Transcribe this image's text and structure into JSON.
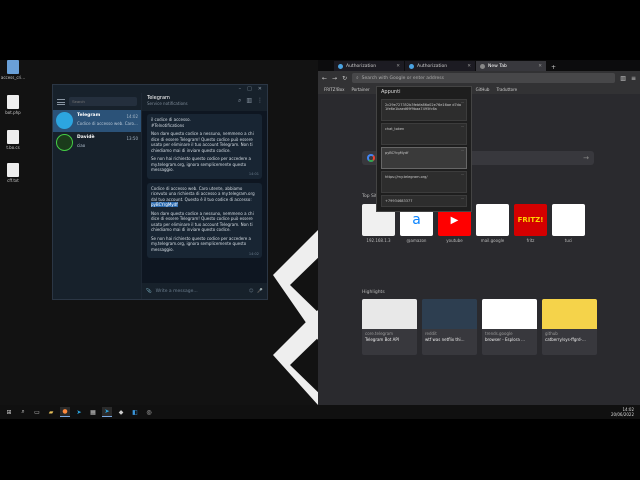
{
  "desktop": {
    "icons": [
      {
        "label": "access_cri..."
      },
      {
        "label": "bot.php"
      },
      {
        "label": "t.bo.cs"
      },
      {
        "label": "cff.txt"
      }
    ]
  },
  "telegram": {
    "search_placeholder": "Search",
    "chats": [
      {
        "name": "Telegram",
        "preview": "Codice di accesso web. Caro...",
        "time": "14:02",
        "avatar_color": "#2ca5e0"
      },
      {
        "name": "Davidè",
        "preview": "ciao",
        "time": "13:50",
        "avatar_color": "#1b3b1b"
      }
    ],
    "header_title": "Telegram",
    "header_subtitle": "Service notifications",
    "msg1": {
      "line1": "il codice di accesso.",
      "line2": "#Telnotifications",
      "para2": "Non dare questo codice a nessuno, nemmeno a chi dice di essere Telegram! Questo codice può essere usato per eliminare il tuo account Telegram. Non ti chiediamo mai di inviare questo codice.",
      "para3": "Se non hai richiesto questo codice per accedere a my.telegram.org, ignora semplicemente questo messaggio.",
      "time": "14:01"
    },
    "msg2": {
      "para1": "Codice di accesso web. Caro utente, abbiamo ricevuto una richiesta di accesso a my.telegram.org dal tuo account. Questo è il tuo codice di accesso:",
      "code": "pyBCYrgMydf",
      "para2": "Non dare questo codice a nessuno, nemmeno a chi dice di essere Telegram! Questo codice può essere usato per eliminare il tuo account Telegram. Non ti chiediamo mai di inviare questo codice.",
      "para3": "Se non hai richiesto questo codice per accedere a my.telegram.org, ignora semplicemente questo messaggio.",
      "time": "14:02"
    },
    "input_placeholder": "Write a message..."
  },
  "browser": {
    "tabs": [
      {
        "label": "Authorization"
      },
      {
        "label": "Authorization"
      },
      {
        "label": "New Tab"
      }
    ],
    "url_placeholder": "Search with Google or enter address",
    "bookmarks": [
      "FRITZ!Box",
      "Portainer",
      "...",
      "YouTube",
      "Trello",
      "Cloudflare",
      "Steam",
      "GitHub",
      "Traduttore"
    ],
    "search_placeholder": "",
    "top_sites_label": "Top Sites",
    "top_sites": [
      {
        "label": "192.168.1.3",
        "color": "#f0f0f0"
      },
      {
        "label": "@amazon",
        "color": "#ffffff"
      },
      {
        "label": "youtube",
        "color": "#ff0000"
      },
      {
        "label": "mail.google",
        "color": "#ffffff"
      },
      {
        "label": "fritz",
        "color": "#d40000"
      },
      {
        "label": "tuci",
        "color": "#ffffff"
      }
    ],
    "highlights_label": "Highlights",
    "highlights": [
      {
        "source": "core.telegram",
        "title": "Telegram Bot API",
        "color": "#e8e8e8"
      },
      {
        "source": "reddit",
        "title": "wtf was netflix thi...",
        "color": "#2d3e50"
      },
      {
        "source": "trends.google",
        "title": "browser - Esplora ...",
        "color": "#ffffff"
      },
      {
        "source": "github",
        "title": "catberry/sys-ffgrd-...",
        "color": "#f5d34a"
      }
    ]
  },
  "clipboard": {
    "title": "Appunti",
    "items": [
      "2c29e727352b3febfa86a02e76e16ae d7da1fe6e1baed69f9baa7495fc6a",
      "chat_token",
      "pyBCYrgMydf",
      "https://my.telegram.org/",
      "+79934683377"
    ]
  },
  "taskbar": {
    "time": "14:02",
    "date": "20/06/2022"
  }
}
